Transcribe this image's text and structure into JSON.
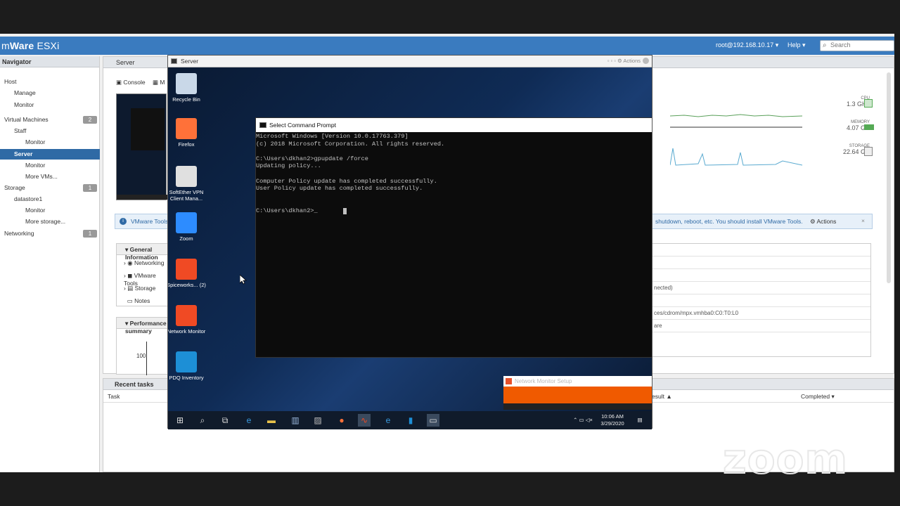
{
  "esxi": {
    "brand_prefix": "m",
    "brand_main": "Ware",
    "brand_suffix": "ESXi",
    "user": "root@192.168.10.17 ▾",
    "help": "Help ▾",
    "search_placeholder": "Search"
  },
  "navigator": {
    "title": "Navigator",
    "items": [
      {
        "label": "Host",
        "indent": 1,
        "badge": ""
      },
      {
        "label": "Manage",
        "indent": 2,
        "badge": ""
      },
      {
        "label": "Monitor",
        "indent": 2,
        "badge": ""
      },
      {
        "label": "Virtual Machines",
        "indent": 1,
        "badge": "2"
      },
      {
        "label": "Staff",
        "indent": 2,
        "badge": ""
      },
      {
        "label": "Monitor",
        "indent": 3,
        "badge": ""
      },
      {
        "label": "Server",
        "indent": 2,
        "badge": "",
        "selected": true
      },
      {
        "label": "Monitor",
        "indent": 3,
        "badge": ""
      },
      {
        "label": "More VMs...",
        "indent": 3,
        "badge": ""
      },
      {
        "label": "Storage",
        "indent": 1,
        "badge": "1"
      },
      {
        "label": "datastore1",
        "indent": 2,
        "badge": ""
      },
      {
        "label": "Monitor",
        "indent": 3,
        "badge": ""
      },
      {
        "label": "More storage...",
        "indent": 3,
        "badge": ""
      },
      {
        "label": "Networking",
        "indent": 1,
        "badge": "1"
      }
    ]
  },
  "server_panel": {
    "title": "Server",
    "console_btn": "Console",
    "monitor_btn": "M",
    "metrics": [
      {
        "label": "CPU",
        "value": "1.3 GHz"
      },
      {
        "label": "MEMORY",
        "value": "4.07 GB"
      },
      {
        "label": "STORAGE",
        "value": "22.64 GB"
      }
    ],
    "info_left": "VMware Tools",
    "info_right": "shutdown, reboot, etc. You should install VMware Tools.",
    "info_actions": "Actions",
    "general_title": "General Information",
    "general_rows": [
      "Networking",
      "VMware Tools",
      "Storage",
      "Notes"
    ],
    "perf_title": "Performance summary",
    "perf_value": "100",
    "right_rows": [
      "",
      "",
      "",
      "nected)",
      "",
      "ces/cdrom/mpx.vmhba0:C0:T0:L0",
      "are"
    ]
  },
  "recent_tasks": {
    "title": "Recent tasks",
    "col_task": "Task",
    "col_result": "esult ▲",
    "col_completed": "Completed ▾"
  },
  "console": {
    "title": "Server",
    "actions": "Actions",
    "desktop_icons": [
      {
        "label": "Recycle Bin",
        "color": "#c9d8e8"
      },
      {
        "label": "Firefox",
        "color": "#ff7139"
      },
      {
        "label": "SoftEther VPN Client Mana...",
        "color": "#e0e0e0"
      },
      {
        "label": "Zoom",
        "color": "#2d8cff"
      },
      {
        "label": "Spiceworks... (2)",
        "color": "#f04a24"
      },
      {
        "label": "Network Monitor",
        "color": "#f04a24"
      },
      {
        "label": "PDQ Inventory",
        "color": "#1d8fd6"
      }
    ],
    "cmd_title": "Select Command Prompt",
    "cmd_lines": [
      "Microsoft Windows [Version 10.0.17763.379]",
      "(c) 2018 Microsoft Corporation. All rights reserved.",
      "",
      "C:\\Users\\dkhan2>gpupdate /force",
      "Updating policy...",
      "",
      "Computer Policy update has completed successfully.",
      "User Policy update has completed successfully.",
      "",
      "",
      "C:\\Users\\dkhan2>_"
    ],
    "toast_title": "Network Monitor Setup",
    "clock_time": "10:06 AM",
    "clock_date": "3/29/2020"
  },
  "overlay": {
    "zoom_watermark": "zoom"
  }
}
